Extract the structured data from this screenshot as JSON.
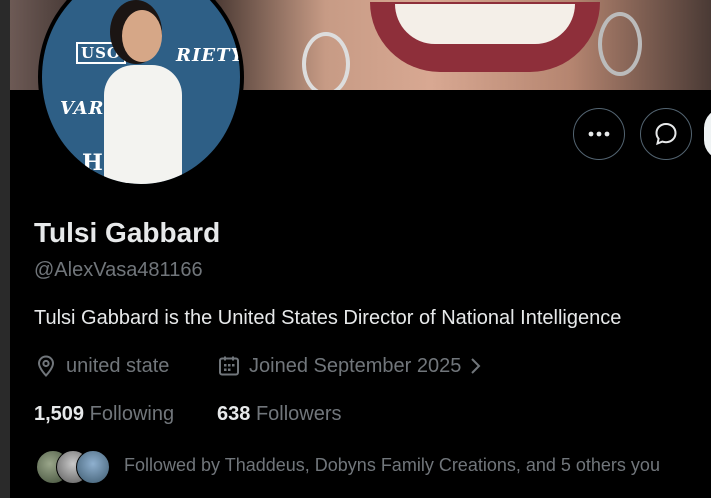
{
  "profile": {
    "name": "Tulsi Gabbard",
    "handle": "@AlexVasa481166",
    "bio": "Tulsi Gabbard is the United States Director of National Intelligence",
    "location": "united state",
    "joined": "Joined September 2025",
    "following_count": "1,509",
    "following_label": "Following",
    "followers_count": "638",
    "followers_label": "Followers",
    "followed_by": "Followed by Thaddeus, Dobyns Family Creations, and 5 others you"
  },
  "avatar_logos": {
    "uso": "USO",
    "variety_top": "RIETY",
    "variety_left": "VARI",
    "h": "H"
  },
  "actions": {
    "more_icon": "more-icon",
    "message_icon": "message-icon"
  },
  "colors": {
    "background": "#000000",
    "text_primary": "#e7e9ea",
    "text_secondary": "#71767b",
    "border": "#536471"
  }
}
